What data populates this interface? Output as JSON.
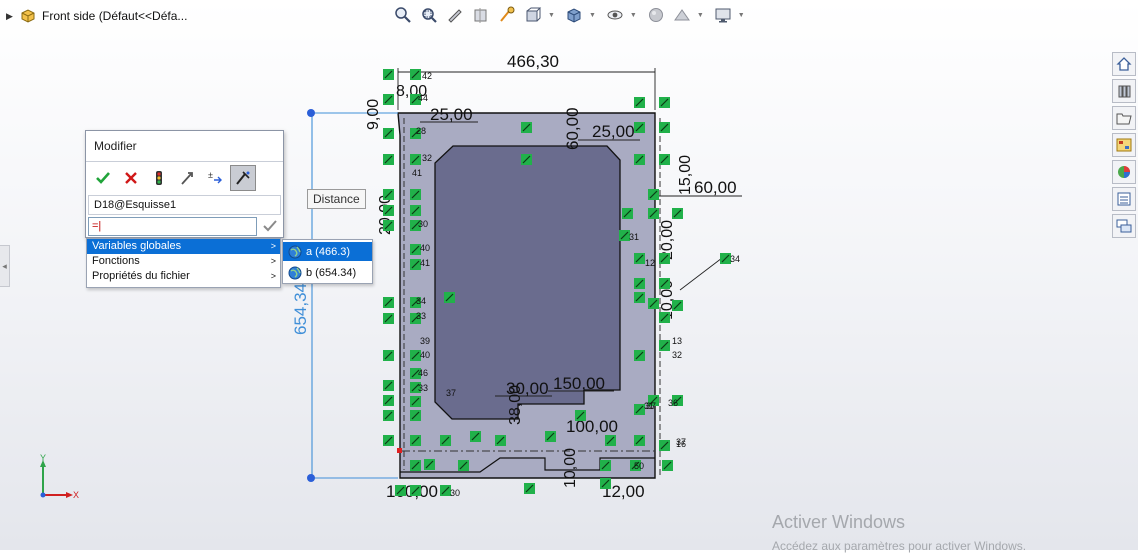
{
  "tree": {
    "item_label": "Front side  (Défaut<<Défa..."
  },
  "modify_dialog": {
    "title": "Modifier",
    "dimension_name": "D18@Esquisse1",
    "value_text": "=|"
  },
  "equation_menu": {
    "items": [
      {
        "label": "Variables globales",
        "arrow": ">"
      },
      {
        "label": "Fonctions",
        "arrow": ">"
      },
      {
        "label": "Propriétés du fichier",
        "arrow": ">"
      }
    ]
  },
  "global_vars_submenu": {
    "items": [
      {
        "label": "a (466.3)"
      },
      {
        "label": "b (654.34)"
      }
    ]
  },
  "tooltip": "Distance",
  "dimensions": {
    "top_width": "466,30",
    "left_height": "654,34",
    "d25_left": "25,00",
    "d25_right": "25,00",
    "d60_top": "60,00",
    "d60_right": "60,00",
    "d9": "9,00",
    "d8": "8,00",
    "d20_left": "20,00",
    "d30_bottom": "30,00",
    "d150": "150,00",
    "d100": "100,00",
    "d38": "38,00",
    "d10_bottom": "10,00",
    "d12": "12,00",
    "d100_bottom": "100,00",
    "d20_side": "20,00",
    "d15": "15,00",
    "d10_side": "10,00"
  },
  "constraint_numbers": [
    "42",
    "44",
    "28",
    "32",
    "41",
    "31",
    "30",
    "40",
    "41",
    "34",
    "33",
    "39",
    "40",
    "46",
    "33",
    "37",
    "31",
    "12",
    "34",
    "13",
    "32",
    "37",
    "36",
    "50",
    "30",
    "37",
    "16"
  ],
  "watermark": {
    "line1": "Activer Windows",
    "line2": "Accédez aux paramètres pour activer Windows."
  },
  "colors": {
    "accent_blue": "#0b6fd6",
    "relation_green": "#21b14a",
    "part_fill": "#a9abc2",
    "pocket_fill": "#6a6c8e",
    "dimension_blue": "#3f8fd8"
  },
  "icons": {
    "tree": [
      "tree-expand-arrow-icon",
      "part-icon"
    ],
    "toolbar": [
      "zoom-to-fit-icon",
      "zoom-area-icon",
      "previous-view-icon",
      "section-view-icon",
      "dynamic-annotation-icon",
      "view-orientation-icon",
      "display-style-icon",
      "hide-show-icon",
      "edit-appearance-icon",
      "apply-scene-icon",
      "view-settings-icon"
    ],
    "right_strip": [
      "home-icon",
      "design-library-icon",
      "file-explorer-icon",
      "view-palette-icon",
      "appearances-icon",
      "custom-properties-icon",
      "forum-icon"
    ],
    "modify_buttons": [
      "accept-icon",
      "cancel-icon",
      "rebuild-icon",
      "reset-selection-icon",
      "spin-increment-icon",
      "mark-dimension-icon"
    ]
  }
}
